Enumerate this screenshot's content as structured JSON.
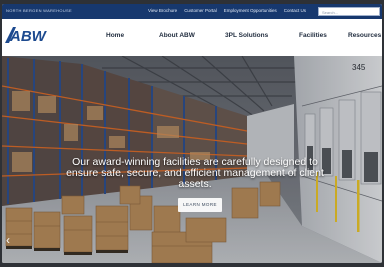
{
  "topbar": {
    "tagline": "NORTH BERGEN WAREHOUSE",
    "links": [
      "View Brochure",
      "Customer Portal",
      "Employment Opportunities",
      "Contact Us"
    ],
    "search_placeholder": "Search..."
  },
  "logo": {
    "text": "ABW"
  },
  "nav": {
    "items": [
      "Home",
      "About ABW",
      "3PL Solutions",
      "Facilities",
      "Resources"
    ]
  },
  "hero": {
    "headline": "Our award-winning facilities are carefully designed to ensure safe, secure, and efficient management of client assets.",
    "cta_label": "LEARN MORE",
    "prev_arrow": "‹",
    "dock_number": "345"
  },
  "colors": {
    "topbar": "#17386e",
    "logo_blue": "#1d4a8f",
    "nav_text": "#1f2b3d"
  }
}
